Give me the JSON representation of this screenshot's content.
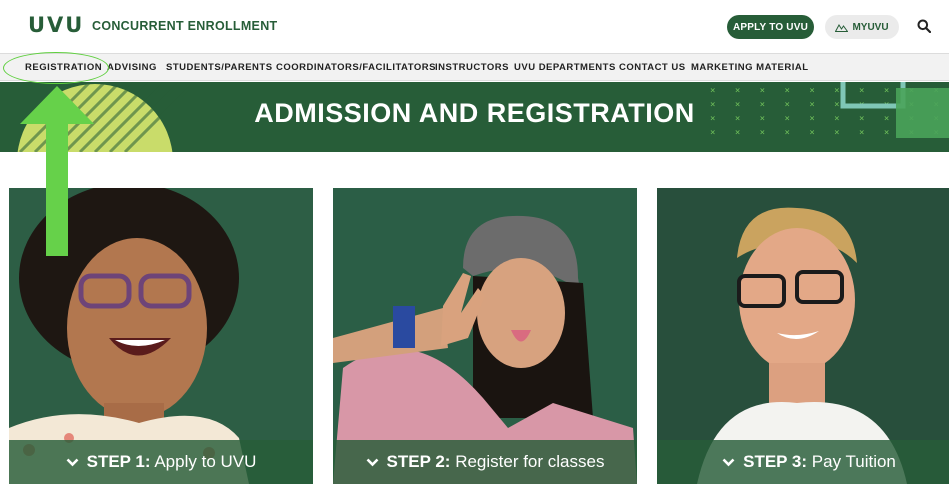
{
  "header": {
    "logo_text": "UVU",
    "site_name": "CONCURRENT ENROLLMENT",
    "apply_label": "APPLY TO UVU",
    "myuvu_label": "MYUVU",
    "search_icon": "search-icon",
    "brand_color": "#275d38"
  },
  "nav": {
    "items": [
      "REGISTRATION",
      "ADVISING",
      "STUDENTS/PARENTS",
      "COORDINATORS/FACILITATORS",
      "INSTRUCTORS",
      "UVU DEPARTMENTS",
      "CONTACT US",
      "MARKETING MATERIAL"
    ]
  },
  "banner": {
    "title": "ADMISSION AND REGISTRATION"
  },
  "annotation": {
    "highlight_color": "#5fcf3f"
  },
  "cards": [
    {
      "step": "STEP 1:",
      "label": "Apply to UVU"
    },
    {
      "step": "STEP 2:",
      "label": "Register for classes"
    },
    {
      "step": "STEP 3:",
      "label": "Pay Tuition"
    }
  ]
}
